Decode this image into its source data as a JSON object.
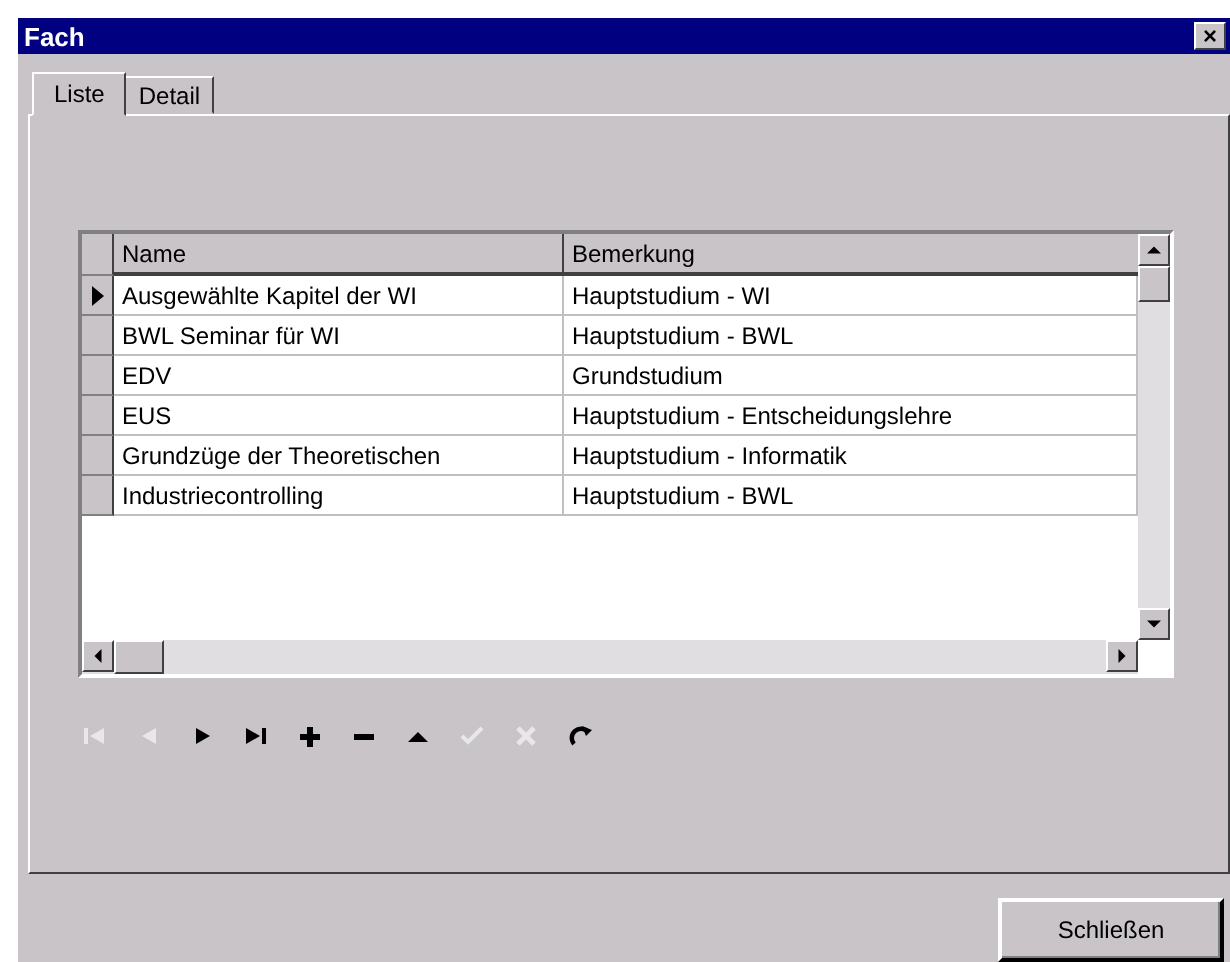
{
  "window": {
    "title": "Fach",
    "close": "×"
  },
  "tabs": [
    {
      "label": "Liste",
      "selected": true
    },
    {
      "label": "Detail",
      "selected": false
    }
  ],
  "table": {
    "columns": [
      "Name",
      "Bemerkung"
    ],
    "rows": [
      {
        "cells": [
          "Ausgewählte Kapitel der WI",
          "Hauptstudium - WI"
        ],
        "selected": true
      },
      {
        "cells": [
          "BWL Seminar für WI",
          "Hauptstudium - BWL"
        ],
        "selected": false
      },
      {
        "cells": [
          "EDV",
          "Grundstudium"
        ],
        "selected": false
      },
      {
        "cells": [
          "EUS",
          "Hauptstudium - Entscheidungslehre"
        ],
        "selected": false
      },
      {
        "cells": [
          "Grundzüge der Theoretischen",
          "Hauptstudium - Informatik"
        ],
        "selected": false
      },
      {
        "cells": [
          "Industriecontrolling",
          "Hauptstudium - BWL"
        ],
        "selected": false
      }
    ]
  },
  "navigator": [
    {
      "kind": "first",
      "disabled": true
    },
    {
      "kind": "prior",
      "disabled": true
    },
    {
      "kind": "next",
      "disabled": false
    },
    {
      "kind": "last",
      "disabled": false
    },
    {
      "kind": "insert",
      "disabled": false
    },
    {
      "kind": "delete",
      "disabled": false
    },
    {
      "kind": "edit",
      "disabled": false
    },
    {
      "kind": "post",
      "disabled": true
    },
    {
      "kind": "cancel",
      "disabled": true
    },
    {
      "kind": "refresh",
      "disabled": false
    }
  ],
  "buttons": [
    "Schließen"
  ]
}
